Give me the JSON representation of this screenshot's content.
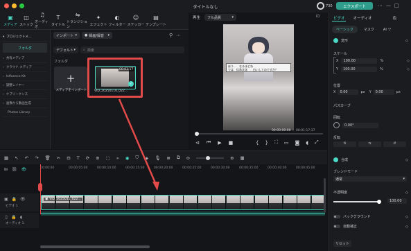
{
  "titlebar": {
    "title": "タイトルなし",
    "export_label": "エクスポート",
    "credits": "730"
  },
  "toolbar": {
    "items": [
      {
        "label": "メディア",
        "icon": "media-icon",
        "glyph": "▣",
        "active": true
      },
      {
        "label": "ストック",
        "icon": "stock-icon",
        "glyph": "◫"
      },
      {
        "label": "オーディオ",
        "icon": "music-icon",
        "glyph": "♫"
      },
      {
        "label": "タイトル",
        "icon": "title-icon",
        "glyph": "T"
      },
      {
        "label": "トランジション",
        "icon": "transition-icon",
        "glyph": "⇋"
      },
      {
        "label": "エフェクト",
        "icon": "effect-icon",
        "glyph": "✦"
      },
      {
        "label": "フィルター",
        "icon": "filter-icon",
        "glyph": "◐"
      },
      {
        "label": "ステッカー",
        "icon": "sticker-icon",
        "glyph": "☺"
      },
      {
        "label": "テンプレート",
        "icon": "template-icon",
        "glyph": "▤"
      }
    ]
  },
  "leftpanel": {
    "header": "プロジェクトメ...",
    "folder": "フォルダ",
    "items": [
      "共有メディア",
      "クラウド メディア",
      "Influence Kit",
      "調整レイヤー",
      "ケブリーケンス",
      "画像から動画生成",
      "Photos Library"
    ]
  },
  "media": {
    "import_label": "インポート",
    "filter_label": "録画/録音",
    "sort_label": "デフォルト",
    "search_placeholder": "検索",
    "folder_label": "フォルダ",
    "import_tile_label": "メディアをインポート",
    "clip_name": "VID_20250110_022...",
    "clip_duration": "00:01:17"
  },
  "player": {
    "tab_label": "再生",
    "quality": "フル品質",
    "subtitle_line1": "ほう…　なるほどね",
    "subtitle_line2": "では　伝承文化　　白いしてのですか？",
    "time_current": "00:00:00:00",
    "time_total": "00:01:17:37"
  },
  "inspector": {
    "tabs": [
      "ビデオ",
      "オーディオ",
      "色"
    ],
    "subtabs": [
      "ベーシック",
      "マスク",
      "AI ツ"
    ],
    "transform": "変形",
    "scale": "スケール",
    "scale_x": "100.00",
    "scale_y": "100.00",
    "scale_unit": "%",
    "position": "位置",
    "pos_x": "0.00",
    "pos_y": "0.00",
    "pos_unit": "px",
    "path_curve": "パスカーブ",
    "rotate": "回転",
    "rotate_value": "0.00°",
    "flip": "反転",
    "composite": "合成",
    "blend_mode": "ブレンドモード",
    "blend_value": "通常",
    "opacity": "不透明度",
    "opacity_value": "100.00",
    "background": "バックグラウンド",
    "auto_correct": "自動補正",
    "reset": "リセット",
    "opacity_fraction": 1.0
  },
  "timeline": {
    "ticks": [
      "00:00:00",
      "00:00:05:00",
      "00:00:10:00",
      "00:00:15:00",
      "00:00:20:00",
      "00:00:25:00",
      "00:00:30:00",
      "00:00:35:00",
      "00:00:40:00",
      "00:00:45:00"
    ],
    "video_track": "ビデオ 1",
    "audio_track": "オーディオ 1",
    "clip_label": "VID_2025011_022...",
    "playhead_time": "00:00:00"
  },
  "colors": {
    "accent": "#4bd9c6",
    "export": "#2e9d8c",
    "annotation": "#e34b4b"
  }
}
